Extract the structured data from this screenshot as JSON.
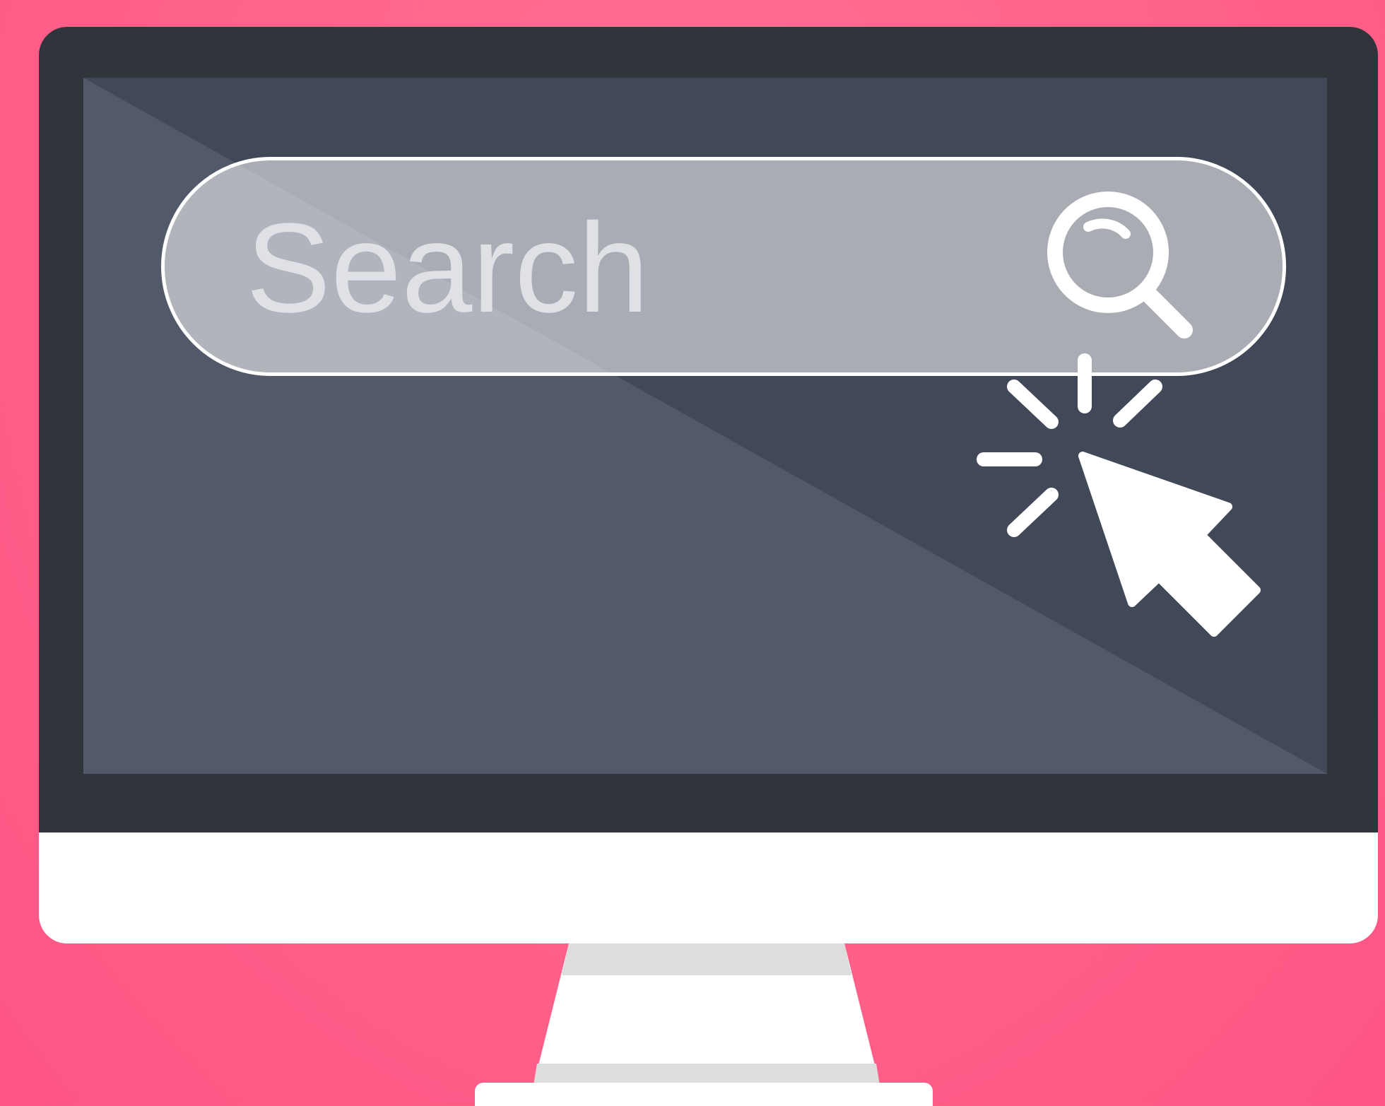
{
  "search": {
    "placeholder": "Search",
    "icon": "magnifier-icon"
  },
  "cursor": {
    "icon": "arrow-pointer-icon",
    "state": "clicking"
  },
  "colors": {
    "background": "#ff628a",
    "bezel": "#30343b",
    "screen": "#414958",
    "screen_light": "#525a69",
    "chin": "#ffffff",
    "search_fill": "#aeb1b8",
    "search_text": "#dfe1e6"
  }
}
